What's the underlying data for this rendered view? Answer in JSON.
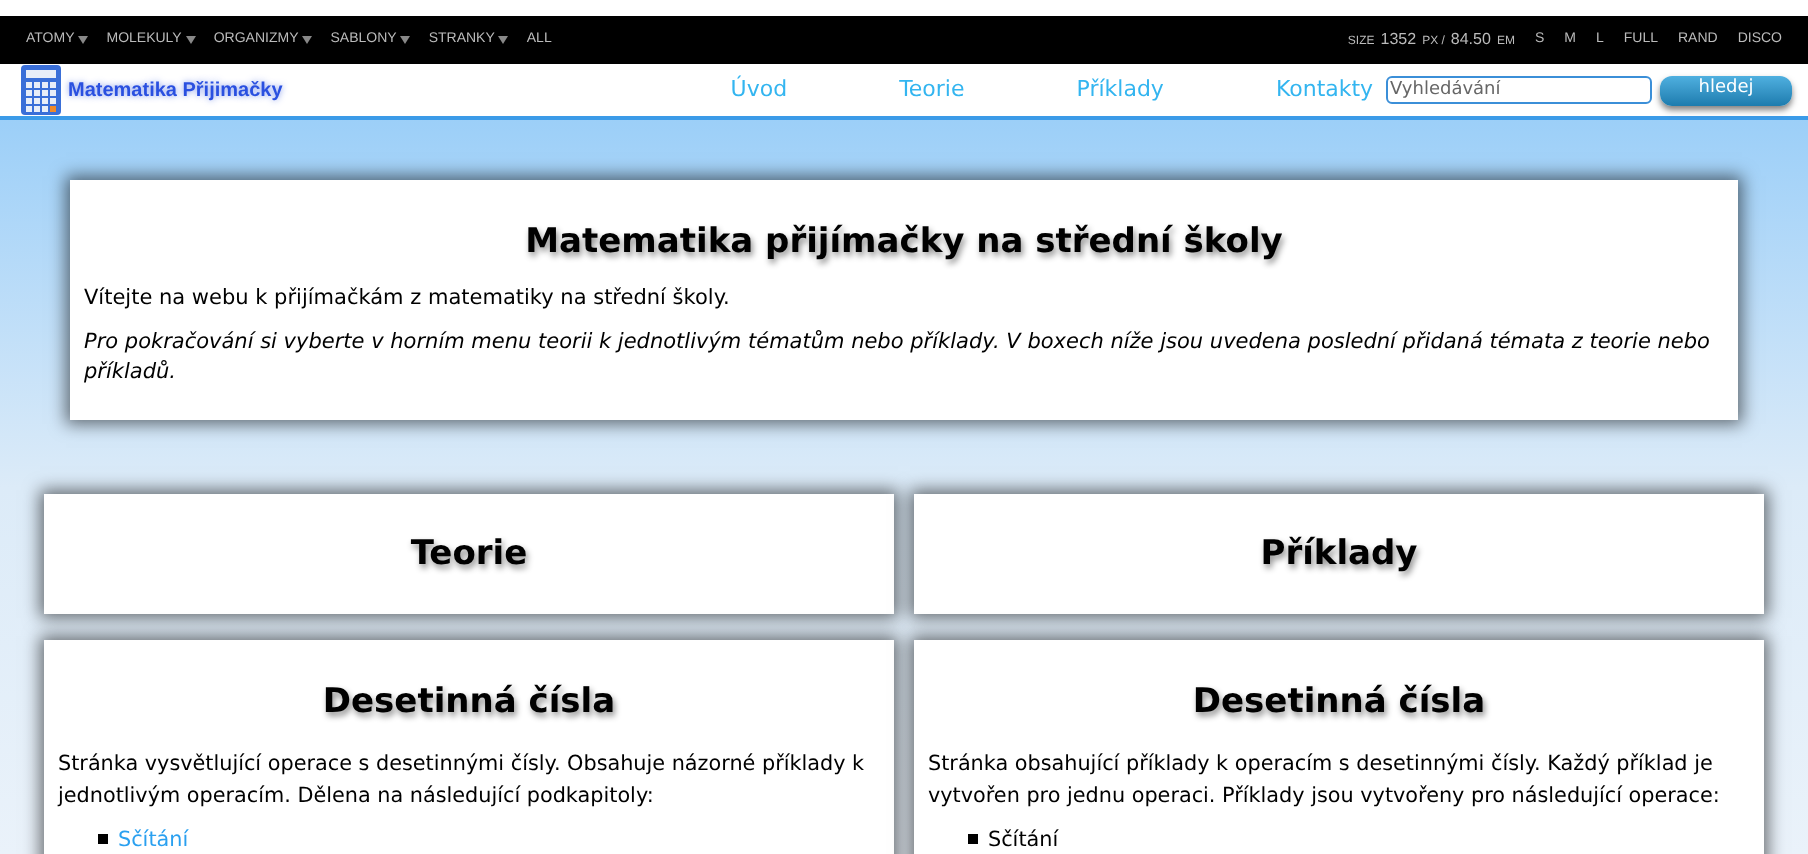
{
  "topbar": {
    "menus": [
      {
        "label": "ATOMY",
        "dropdown": true
      },
      {
        "label": "MOLEKULY",
        "dropdown": true
      },
      {
        "label": "ORGANIZMY",
        "dropdown": true
      },
      {
        "label": "SABLONY",
        "dropdown": true
      },
      {
        "label": "STRANKY",
        "dropdown": true
      },
      {
        "label": "ALL",
        "dropdown": false
      }
    ],
    "size_label": "SIZE",
    "size_value": "1352",
    "size_unit1": "PX /",
    "size_em": "84.50",
    "size_unit2": "EM",
    "options": [
      "S",
      "M",
      "L",
      "FULL",
      "RAND",
      "DISCO"
    ]
  },
  "header": {
    "logo_text": "Matematika Přijimačky",
    "nav": [
      "Úvod",
      "Teorie",
      "Příklady",
      "Kontakty"
    ],
    "search": {
      "placeholder": "Vyhledávání"
    },
    "search_button": "hledej"
  },
  "intro": {
    "title": "Matematika přijímačky na střední školy",
    "text": "Vítejte na webu k přijímačkám z matematiky na střední školy.",
    "note": "Pro pokračování si vyberte v horním menu teorii k jednotlivým tématům nebo příklady. V boxech níže jsou uvedena poslední přidaná témata z teorie nebo příkladů."
  },
  "columns": [
    {
      "heading": "Teorie",
      "card": {
        "title": "Desetinná čísla",
        "text": "Stránka vysvětlující operace s desetinnými čísly. Obsahuje názorné příklady k jednotlivým operacím. Dělena na následující podkapitoly:",
        "items": [
          {
            "label": "Sčítání",
            "link": true
          }
        ]
      }
    },
    {
      "heading": "Příklady",
      "card": {
        "title": "Desetinná čísla",
        "text": "Stránka obsahující příklady k operacím s desetinnými čísly. Každý příklad je vytvořen pro jednu operaci. Příklady jsou vytvořeny pro následující operace:",
        "items": [
          {
            "label": "Sčítání",
            "link": false
          }
        ]
      }
    }
  ]
}
